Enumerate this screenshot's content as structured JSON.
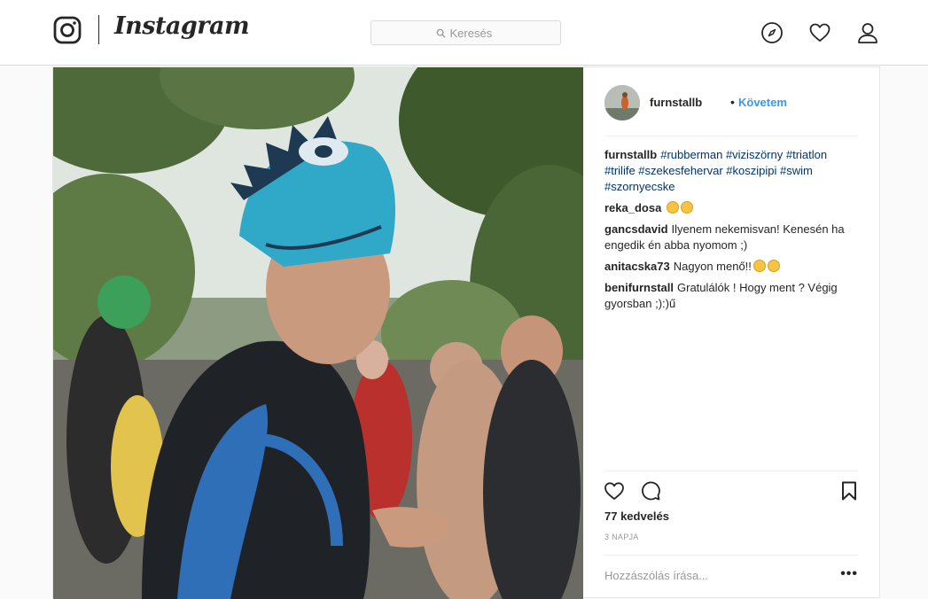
{
  "app": {
    "wordmark": "Instagram"
  },
  "search": {
    "placeholder": "Keresés"
  },
  "nav": {
    "icons": [
      "compass-icon",
      "heart-icon",
      "user-icon"
    ]
  },
  "post": {
    "author": "furnstallb",
    "separator": "•",
    "follow_label": "Követem",
    "caption": {
      "user": "furnstallb",
      "text": "#rubberman #viziszörny #triatlon #trilife #szekesfehervar #koszipipi #swim #szornyecske"
    },
    "comments": [
      {
        "user": "reka_dosa",
        "text": ""
      },
      {
        "user": "gancsdavid",
        "text": "Ilyenem nekemisvan! Kenesén ha engedik én abba nyomom ;)"
      },
      {
        "user": "anitacska73",
        "text": "Nagyon menő!!"
      },
      {
        "user": "benifurnstall",
        "text": "Gratulálók ! Hogy ment ? Végig gyorsban ;):)ű"
      }
    ],
    "likes": "77 kedvelés",
    "time": "3 NAPJA",
    "comment_placeholder": "Hozzászólás írása...",
    "more_label": "•••"
  },
  "colors": {
    "link": "#3897f0",
    "hashtag": "#003569",
    "border": "#dbdbdb"
  }
}
